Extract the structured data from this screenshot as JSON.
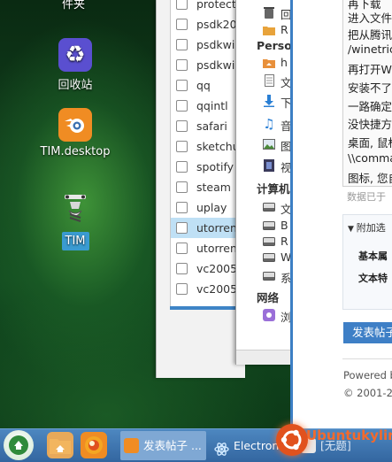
{
  "desktop": {
    "top_label": "件夹",
    "icons": [
      {
        "label": "回收站",
        "icon": "recycle-bin-icon"
      },
      {
        "label": "TIM.desktop",
        "icon": "blender-icon"
      },
      {
        "label": "TIM",
        "icon": "tim-icon"
      }
    ]
  },
  "file_list": {
    "items": [
      "protect",
      "psdk200",
      "psdkwin",
      "psdkwin",
      "qq",
      "qqintl",
      "safari",
      "sketchup",
      "spotify",
      "steam",
      "uplay",
      "utorrent",
      "utorrent",
      "vc2005e",
      "vc2005e"
    ],
    "selected_index": 11
  },
  "file_manager": {
    "top_items": [
      {
        "icon": "trash-icon",
        "text": "回"
      },
      {
        "icon": "folder-icon",
        "text": "R"
      }
    ],
    "personal_label": "Perso",
    "personal_items": [
      {
        "icon": "home-folder-icon",
        "text": "h"
      },
      {
        "icon": "document-icon",
        "text": "文"
      },
      {
        "icon": "download-icon",
        "text": "下"
      },
      {
        "icon": "music-icon",
        "text": "音"
      },
      {
        "icon": "picture-icon",
        "text": "图"
      },
      {
        "icon": "video-icon",
        "text": "视"
      }
    ],
    "computer_label": "计算机",
    "computer_items": [
      {
        "icon": "drive-icon",
        "text": "文"
      },
      {
        "icon": "drive-icon",
        "text": "B"
      },
      {
        "icon": "drive-icon",
        "text": "R"
      },
      {
        "icon": "drive-icon",
        "text": "W"
      },
      {
        "icon": "drive-icon",
        "text": "系"
      }
    ],
    "network_label": "网络",
    "network_items": [
      {
        "icon": "network-icon",
        "text": "浏"
      }
    ]
  },
  "browser": {
    "editor_lines": [
      "再下载",
      "进入文件",
      "把从腾讯",
      "/winetric",
      "再打开W",
      "安装不了",
      "一路确定",
      "没快捷方",
      "桌面, 鼠标",
      "\\\\comma",
      "图标, 您自"
    ],
    "status": "数据已于",
    "attach_header": "附加选",
    "attach_items": [
      "基本属",
      "文本特"
    ],
    "post_button": "发表帖子",
    "footer_powered": "Powered b",
    "footer_copyright": "© 2001-20"
  },
  "taskbar": {
    "tasks": [
      {
        "label": "发表帖子 ...",
        "icon": "firefox-icon",
        "active": true
      },
      {
        "label": "Electron",
        "icon": "electron-icon",
        "active": false
      },
      {
        "label": "[无题]",
        "icon": "editor-icon",
        "active": false
      }
    ],
    "watermark": "Ubuntukylin"
  },
  "colors": {
    "accent": "#3e7fc6",
    "selection": "#bfe0f5",
    "taskbar": "#3d73ad",
    "ubuntu_orange": "#e1521e"
  }
}
